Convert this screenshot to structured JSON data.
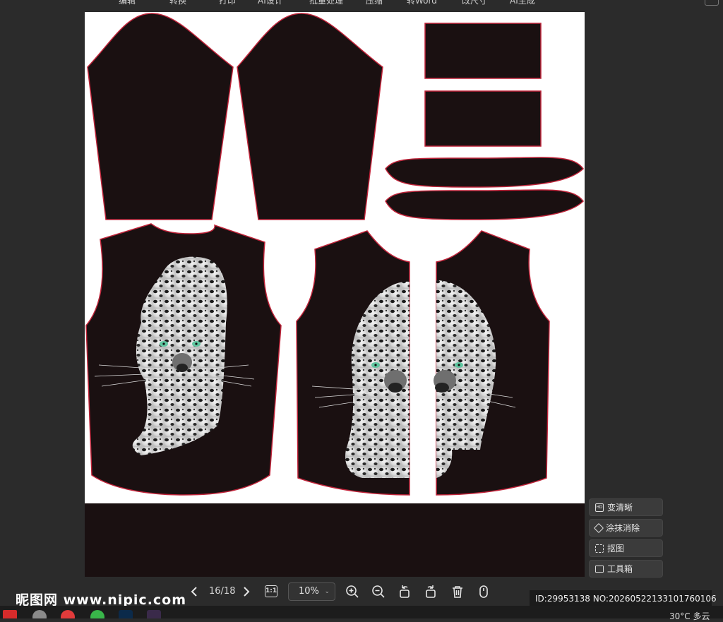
{
  "top_toolbar": {
    "items": [
      "编辑",
      "转换",
      "打印",
      "AI设计",
      "批量处理",
      "压缩",
      "转Word",
      "改尺寸",
      "AI生成"
    ]
  },
  "canvas": {
    "description_colors": {
      "panel_fill": "#1a1011",
      "panel_outline": "#c0243a",
      "background": "#ffffff"
    }
  },
  "side_panel": {
    "buttons": [
      {
        "label": "变清晰",
        "icon": "hd-icon"
      },
      {
        "label": "涂抹消除",
        "icon": "eraser-icon"
      },
      {
        "label": "抠图",
        "icon": "cutout-icon"
      },
      {
        "label": "工具箱",
        "icon": "toolbox-icon"
      }
    ]
  },
  "bottom_bar": {
    "watermark": "昵图网 www.nipic.com",
    "page_counter": "16/18",
    "ratio_label": "1:1",
    "zoom_value": "10%",
    "id_text": "ID:29953138 NO:20260522133101760106"
  },
  "taskbar": {
    "weather": "30°C 多云"
  }
}
